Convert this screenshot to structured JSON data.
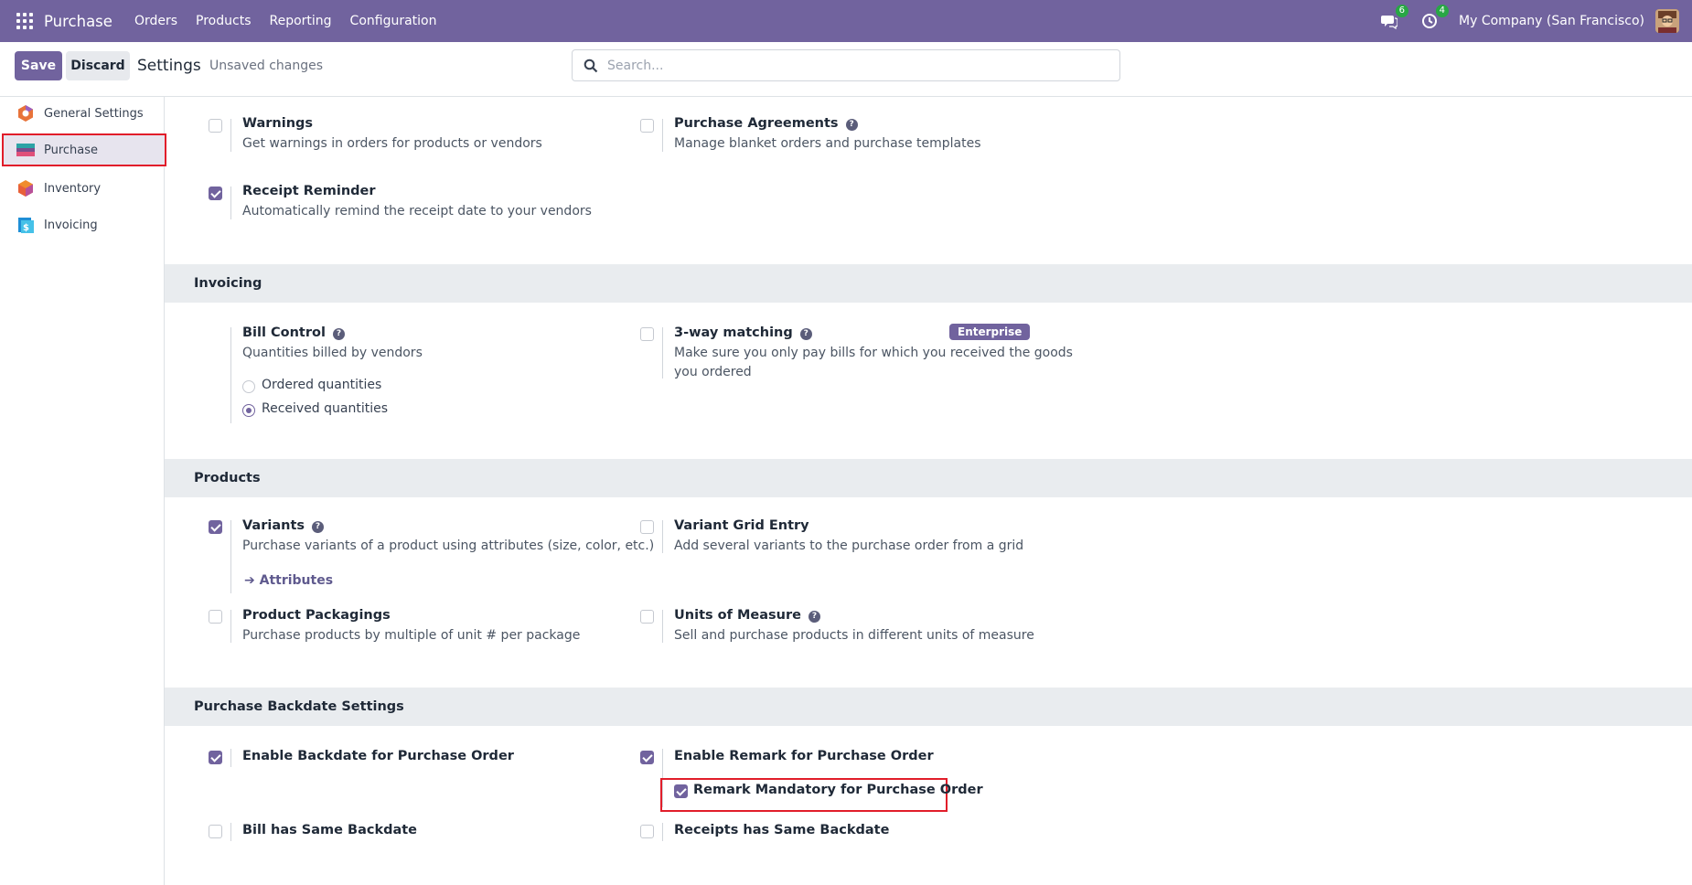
{
  "navbar": {
    "app_name": "Purchase",
    "menu": [
      "Orders",
      "Products",
      "Reporting",
      "Configuration"
    ],
    "messages_count": "6",
    "activities_count": "4",
    "company": "My Company (San Francisco)"
  },
  "control": {
    "save_label": "Save",
    "discard_label": "Discard",
    "title": "Settings",
    "status": "Unsaved changes",
    "search_placeholder": "Search..."
  },
  "sidebar": {
    "items": [
      {
        "label": "General Settings",
        "icon": "settings-app-icon"
      },
      {
        "label": "Purchase",
        "icon": "purchase-app-icon",
        "active": true
      },
      {
        "label": "Inventory",
        "icon": "inventory-app-icon"
      },
      {
        "label": "Invoicing",
        "icon": "invoicing-app-icon"
      }
    ]
  },
  "sections": {
    "top": {
      "warnings": {
        "title": "Warnings",
        "desc": "Get warnings in orders for products or vendors",
        "checked": false
      },
      "purchase_agreements": {
        "title": "Purchase Agreements",
        "desc": "Manage blanket orders and purchase templates",
        "checked": false
      },
      "receipt_reminder": {
        "title": "Receipt Reminder",
        "desc": "Automatically remind the receipt date to your vendors",
        "checked": true
      }
    },
    "invoicing": {
      "title": "Invoicing",
      "bill_control": {
        "title": "Bill Control",
        "desc": "Quantities billed by vendors",
        "options": [
          "Ordered quantities",
          "Received quantities"
        ],
        "selected": "Received quantities"
      },
      "three_way": {
        "title": "3-way matching",
        "desc_line1": "Make sure you only pay bills for which you received the goods",
        "desc_line2": "you ordered",
        "badge": "Enterprise",
        "checked": false
      }
    },
    "products": {
      "title": "Products",
      "variants": {
        "title": "Variants",
        "desc": "Purchase variants of a product using attributes (size, color, etc.)",
        "link": "Attributes",
        "checked": true
      },
      "variant_grid": {
        "title": "Variant Grid Entry",
        "desc": "Add several variants to the purchase order from a grid",
        "checked": false
      },
      "packagings": {
        "title": "Product Packagings",
        "desc": "Purchase products by multiple of unit # per package",
        "checked": false
      },
      "uom": {
        "title": "Units of Measure",
        "desc": "Sell and purchase products in different units of measure",
        "checked": false
      }
    },
    "backdate": {
      "title": "Purchase Backdate Settings",
      "enable_backdate": {
        "title": "Enable Backdate for Purchase Order",
        "checked": true
      },
      "enable_remark": {
        "title": "Enable Remark for Purchase Order",
        "checked": true
      },
      "remark_mandatory": {
        "title": "Remark Mandatory for Purchase Order",
        "checked": true
      },
      "bill_same": {
        "title": "Bill has Same Backdate",
        "checked": false
      },
      "receipts_same": {
        "title": "Receipts has Same Backdate",
        "checked": false
      }
    }
  },
  "colors": {
    "brand": "#71639e",
    "highlight": "#e11d2a",
    "badge": "#28a745"
  }
}
